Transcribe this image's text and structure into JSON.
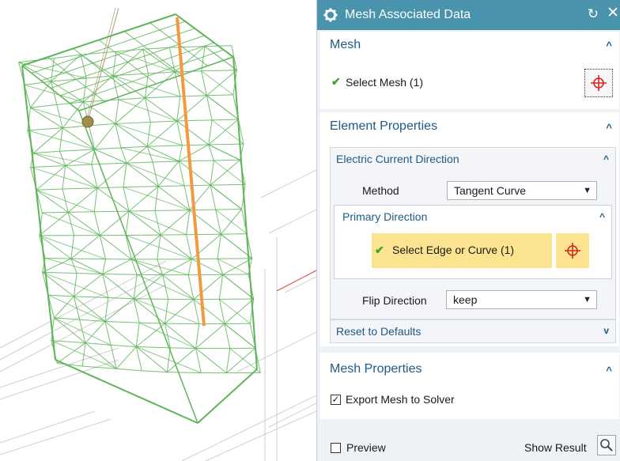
{
  "dialog": {
    "title": "Mesh Associated Data",
    "reset_icon": "reset-icon",
    "close_icon": "close-icon"
  },
  "mesh": {
    "title": "Mesh",
    "select_label": "Select Mesh (1)"
  },
  "element_properties": {
    "title": "Element Properties",
    "current_direction": {
      "title": "Electric Current Direction",
      "method_label": "Method",
      "method_value": "Tangent Curve",
      "primary_direction": {
        "title": "Primary Direction",
        "select_label": "Select Edge or Curve (1)"
      },
      "flip_label": "Flip Direction",
      "flip_value": "keep"
    },
    "reset_defaults": "Reset to Defaults"
  },
  "mesh_properties": {
    "title": "Mesh Properties",
    "export_label": "Export Mesh to Solver",
    "export_checked": true
  },
  "footer": {
    "preview_label": "Preview",
    "preview_checked": false,
    "show_result_label": "Show Result"
  },
  "colors": {
    "title_bar": "#4a93ad",
    "section_title": "#1d5a86",
    "highlight": "#fbe38f",
    "mesh_wire": "#5fb45a",
    "selected_curve": "#f39a3e",
    "check": "#3fa12f"
  }
}
